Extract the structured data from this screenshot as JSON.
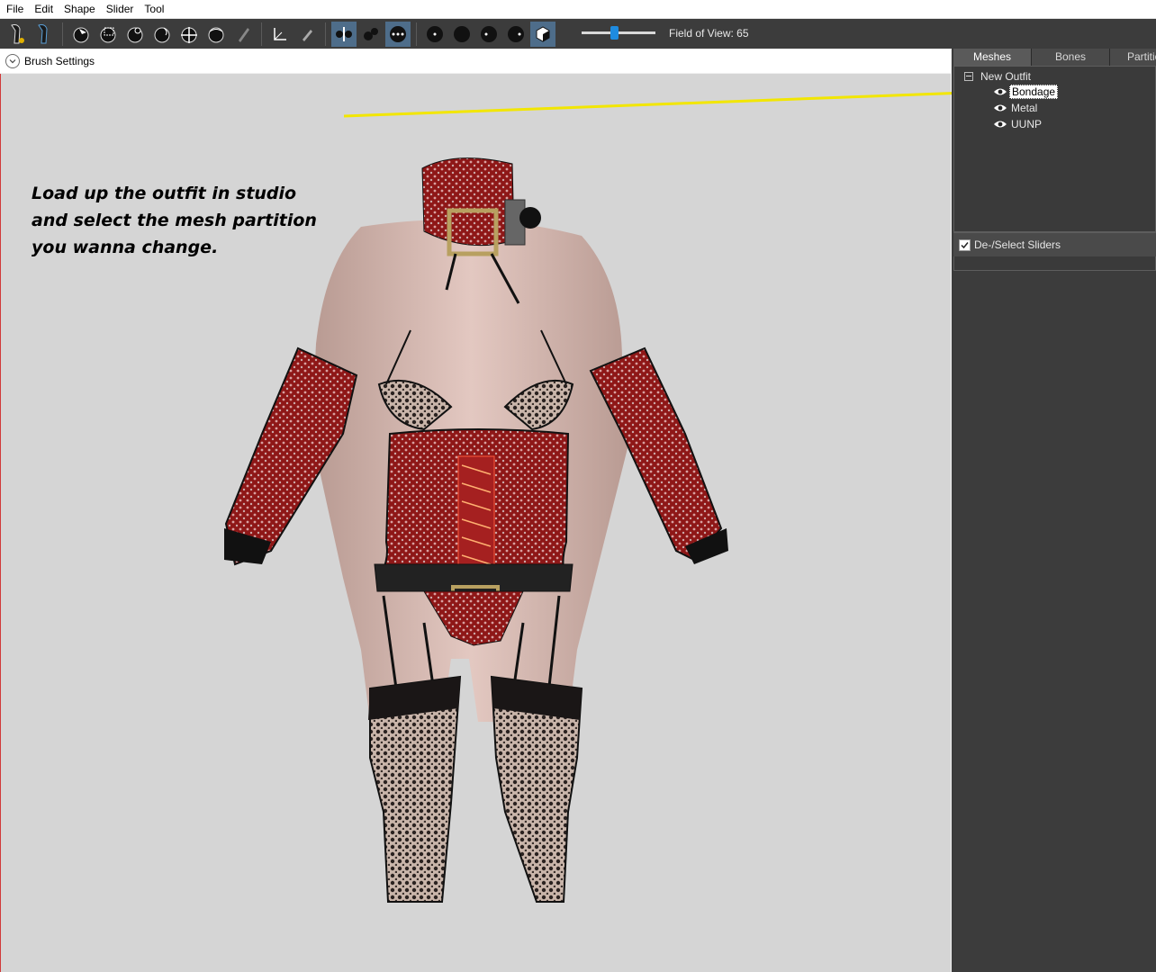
{
  "menu": [
    "File",
    "Edit",
    "Shape",
    "Slider",
    "Tool"
  ],
  "toolbar": {
    "tools": [
      "outfit-icon",
      "ref-icon",
      "select-icon",
      "mask-icon",
      "inflate-icon",
      "deflate-icon",
      "move-icon",
      "smooth-icon",
      "undiff-icon",
      "transform-icon",
      "pen-icon",
      "x-mirror-icon",
      "connected-icon",
      "global-icon",
      "wire-icon",
      "shade-icon",
      "mask-view-icon",
      "weight-icon",
      "texture-icon"
    ],
    "fov_label": "Field of View: 65",
    "fov_value": 65
  },
  "brush_settings": {
    "label": "Brush Settings"
  },
  "viewport": {
    "annotation": [
      "Load up the outfit in studio",
      "and select the mesh partition",
      "you wanna change."
    ]
  },
  "right_panel": {
    "tabs": [
      "Meshes",
      "Bones",
      "Partitions"
    ],
    "root": "New Outfit",
    "meshes": [
      "Bondage",
      "Metal",
      "UUNP"
    ],
    "selected": "Bondage",
    "sliders_header": "De-/Select Sliders"
  },
  "colors": {
    "toolbar": "#3c3c3c",
    "viewport": "#d5d5d5",
    "accent": "#1e8be0",
    "annotation_line": "#f2e600"
  }
}
